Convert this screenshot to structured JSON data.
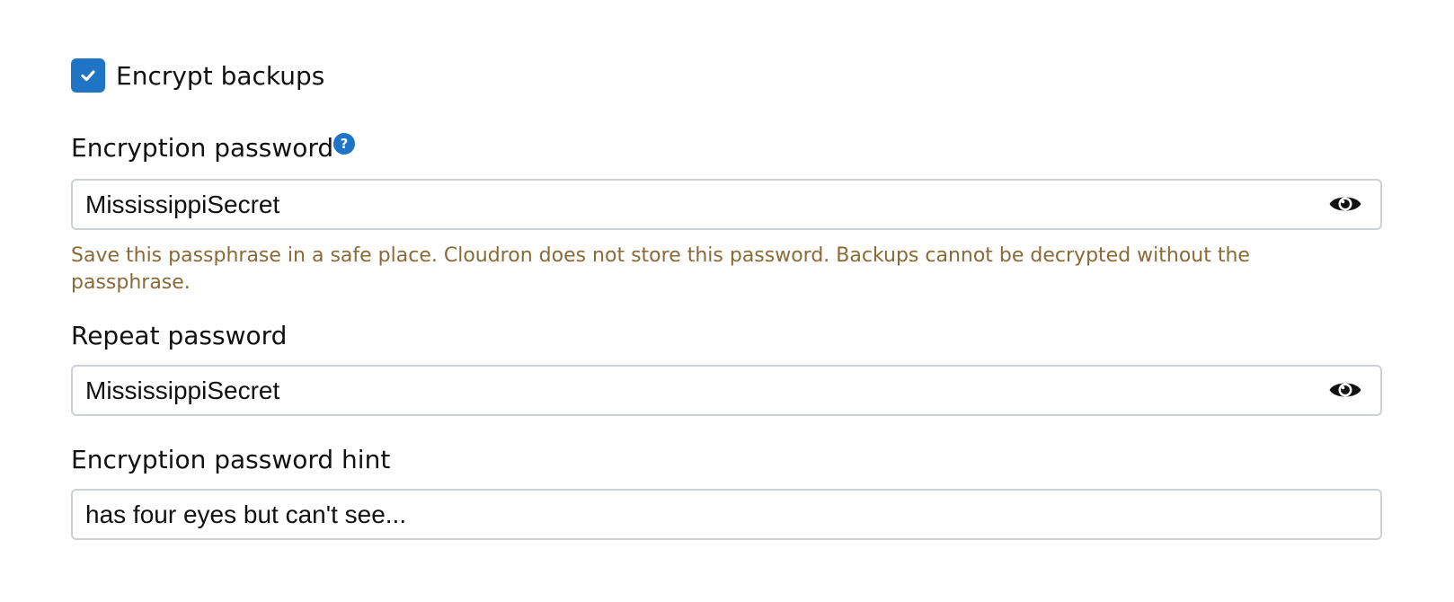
{
  "encrypt_backups": {
    "label": "Encrypt backups",
    "checked": true
  },
  "encryption_password": {
    "label": "Encryption password",
    "help_icon": "question-circle-icon",
    "help_glyph": "?",
    "value": "MississippiSecret",
    "toggle_icon": "eye-icon",
    "warning": "Save this passphrase in a safe place. Cloudron does not store this password. Backups cannot be decrypted without the passphrase."
  },
  "repeat_password": {
    "label": "Repeat password",
    "value": "MississippiSecret",
    "toggle_icon": "eye-icon"
  },
  "password_hint": {
    "label": "Encryption password hint",
    "value": "has four eyes but can't see..."
  },
  "colors": {
    "accent": "#1f74c6",
    "warning_text": "#8a6a36",
    "input_border": "#cdd1d6"
  }
}
